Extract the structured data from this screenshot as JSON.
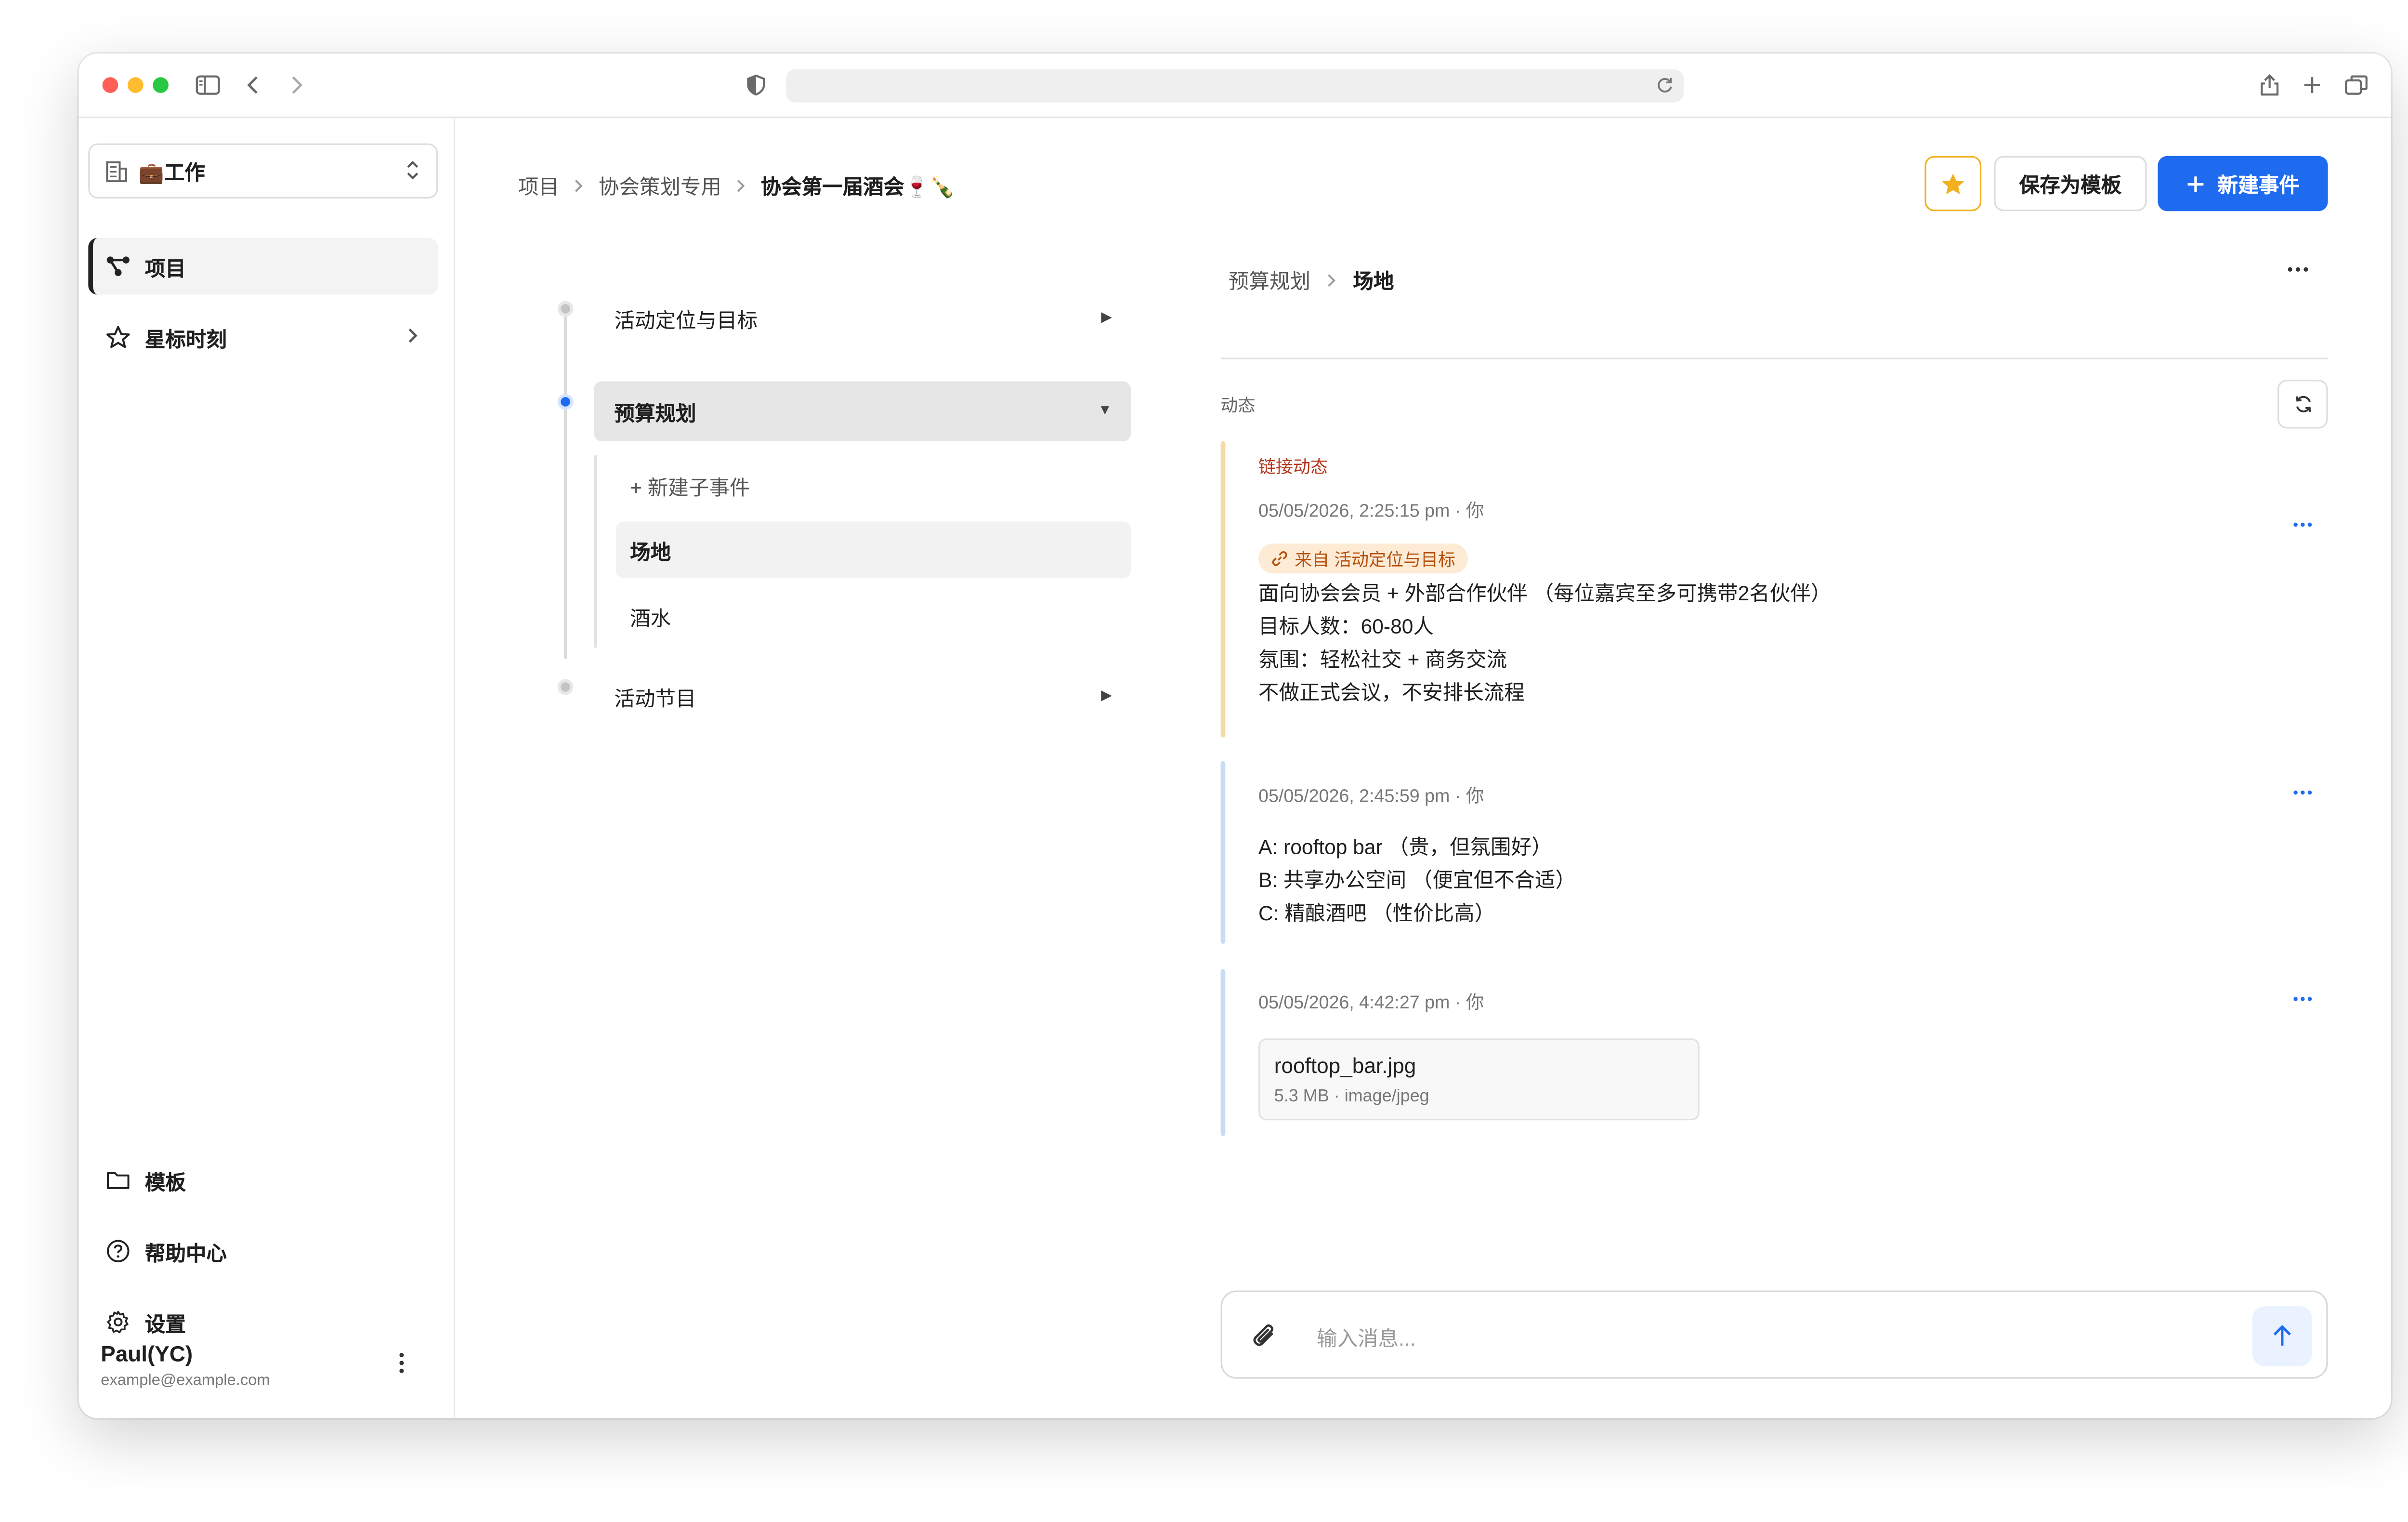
{
  "window": {
    "accent_color": "#1f6bf0",
    "star_color": "#f2b01e"
  },
  "sidebar": {
    "workspace_label": "💼工作",
    "items": [
      {
        "label": "项目",
        "icon": "project-tree-icon",
        "active": true
      },
      {
        "label": "星标时刻",
        "icon": "star-icon"
      }
    ],
    "bottom_items": [
      {
        "label": "模板",
        "icon": "folder-icon"
      },
      {
        "label": "帮助中心",
        "icon": "help-icon"
      },
      {
        "label": "设置",
        "icon": "gear-icon"
      }
    ],
    "user": {
      "name": "Paul(YC)",
      "email": "example@example.com"
    }
  },
  "header": {
    "breadcrumb": [
      "项目",
      "协会策划专用",
      "协会第一届酒会🍷🍾"
    ],
    "save_template_label": "保存为模板",
    "new_event_label": "新建事件"
  },
  "tree": {
    "items": [
      {
        "label": "活动定位与目标",
        "arrow": "▶"
      },
      {
        "label": "预算规划",
        "arrow": "▼",
        "selected": true
      },
      {
        "label": "活动节目",
        "arrow": "▶"
      }
    ],
    "sub_items": [
      {
        "label": "+ 新建子事件"
      },
      {
        "label": "场地",
        "selected": true
      },
      {
        "label": "酒水"
      }
    ]
  },
  "detail": {
    "breadcrumb": [
      "预算规划",
      "场地"
    ],
    "activity_label": "动态",
    "entries": [
      {
        "tag_title": "链接动态",
        "timestamp": "05/05/2026, 2:25:15 pm · 你",
        "chip": "来自 活动定位与目标",
        "lines": [
          "面向协会会员 + 外部合作伙伴 （每位嘉宾至多可携带2名伙伴）",
          "目标人数：60-80人",
          "氛围：轻松社交 + 商务交流",
          "不做正式会议，不安排长流程"
        ]
      },
      {
        "timestamp": "05/05/2026, 2:45:59 pm · 你",
        "lines": [
          "A: rooftop bar （贵，但氛围好）",
          "B: 共享办公空间 （便宜但不合适）",
          "C: 精酿酒吧 （性价比高）"
        ]
      },
      {
        "timestamp": "05/05/2026, 4:42:27 pm · 你",
        "file": {
          "name": "rooftop_bar.jpg",
          "meta": "5.3 MB · image/jpeg"
        }
      }
    ],
    "message_placeholder": "输入消息..."
  }
}
